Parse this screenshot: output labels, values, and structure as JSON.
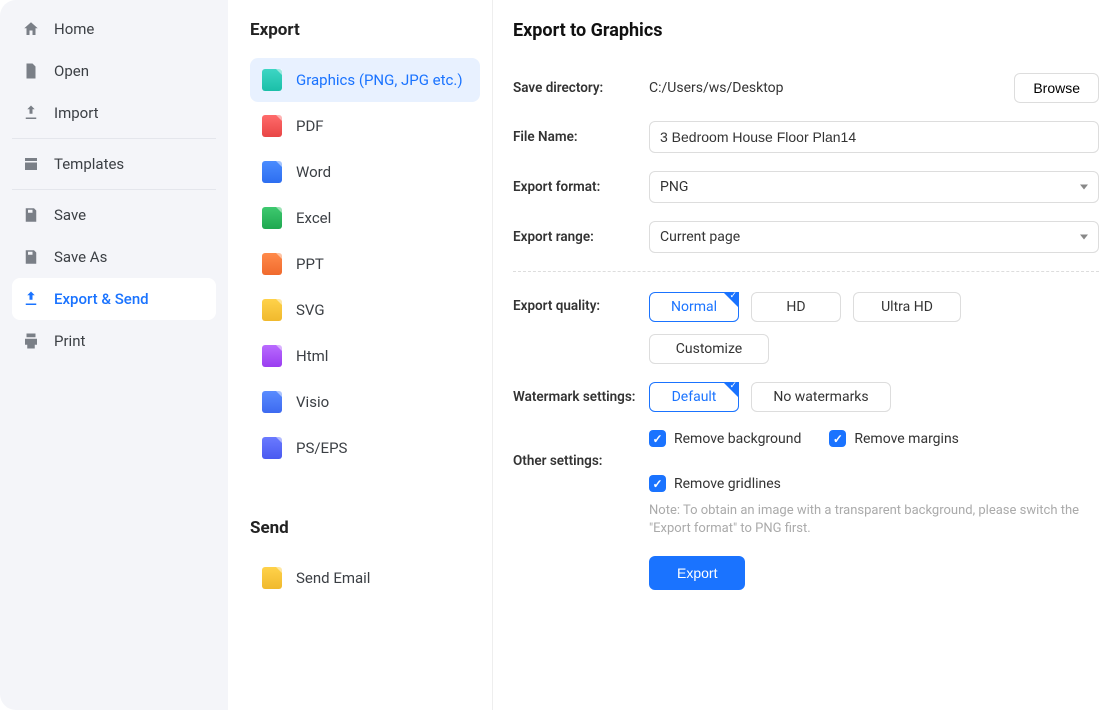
{
  "leftnav": {
    "items": [
      {
        "label": "Home"
      },
      {
        "label": "Open"
      },
      {
        "label": "Import"
      },
      {
        "label": "Templates"
      },
      {
        "label": "Save"
      },
      {
        "label": "Save As"
      },
      {
        "label": "Export & Send"
      },
      {
        "label": "Print"
      }
    ]
  },
  "midcol": {
    "export_heading": "Export",
    "send_heading": "Send",
    "formats": [
      {
        "label": "Graphics (PNG, JPG etc.)"
      },
      {
        "label": "PDF"
      },
      {
        "label": "Word"
      },
      {
        "label": "Excel"
      },
      {
        "label": "PPT"
      },
      {
        "label": "SVG"
      },
      {
        "label": "Html"
      },
      {
        "label": "Visio"
      },
      {
        "label": "PS/EPS"
      }
    ],
    "send_items": [
      {
        "label": "Send Email"
      }
    ]
  },
  "detail": {
    "title": "Export to Graphics",
    "labels": {
      "save_directory": "Save directory:",
      "file_name": "File Name:",
      "export_format": "Export format:",
      "export_range": "Export range:",
      "export_quality": "Export quality:",
      "watermark_settings": "Watermark settings:",
      "other_settings": "Other settings:"
    },
    "save_directory_value": "C:/Users/ws/Desktop",
    "browse_label": "Browse",
    "file_name_value": "3 Bedroom House Floor Plan14",
    "export_format_value": "PNG",
    "export_range_value": "Current page",
    "quality": {
      "normal": "Normal",
      "hd": "HD",
      "ultra_hd": "Ultra HD",
      "customize": "Customize"
    },
    "watermark": {
      "default": "Default",
      "none": "No watermarks"
    },
    "other": {
      "remove_background": "Remove background",
      "remove_margins": "Remove margins",
      "remove_gridlines": "Remove gridlines"
    },
    "note": "Note: To obtain an image with a transparent background, please switch the \"Export format\" to PNG first.",
    "export_button": "Export"
  }
}
